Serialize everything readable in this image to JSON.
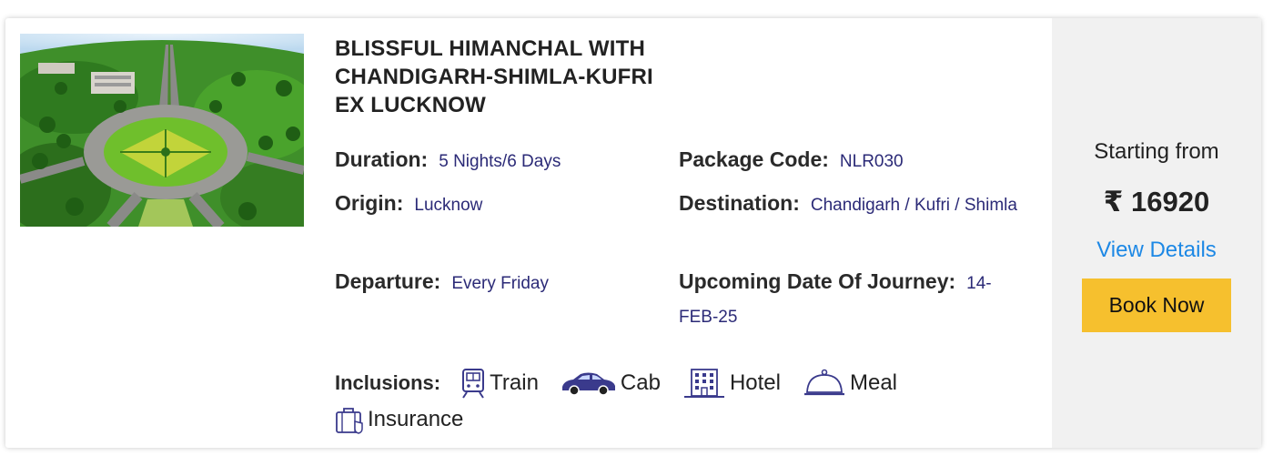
{
  "package": {
    "title_line1": "BLISSFUL HIMANCHAL WITH",
    "title_line2": "CHANDIGARH-SHIMLA-KUFRI",
    "title_line3": "EX LUCKNOW",
    "duration_label": "Duration:",
    "duration_value": "5 Nights/6 Days",
    "code_label": "Package Code:",
    "code_value": "NLR030",
    "origin_label": "Origin:",
    "origin_value": "Lucknow",
    "destination_label": "Destination:",
    "destination_value": "Chandigarh / Kufri / Shimla",
    "departure_label": "Departure:",
    "departure_value": "Every Friday",
    "journey_label": "Upcoming Date Of Journey:",
    "journey_value": "14-FEB-25"
  },
  "inclusions": {
    "label": "Inclusions:",
    "items": [
      {
        "label": "Train",
        "icon": "train-icon"
      },
      {
        "label": "Cab",
        "icon": "car-icon"
      },
      {
        "label": "Hotel",
        "icon": "hotel-icon"
      },
      {
        "label": "Meal",
        "icon": "meal-cloche-icon"
      },
      {
        "label": "Insurance",
        "icon": "insurance-briefcase-icon"
      }
    ]
  },
  "pricing": {
    "starting_label": "Starting from",
    "price": "₹ 16920",
    "view_details": "View Details",
    "book_now": "Book Now"
  },
  "colors": {
    "value_text": "#2b2a77",
    "link": "#1d88e5",
    "book_button": "#f6c02e",
    "side_panel": "#f1f1f1",
    "icon": "#3a3a8c"
  }
}
